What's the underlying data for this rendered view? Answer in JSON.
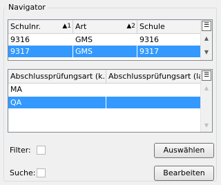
{
  "group": {
    "title": "Navigator"
  },
  "schools": {
    "columns": [
      {
        "label": "Schulnr.",
        "sort": "▲1"
      },
      {
        "label": "Art",
        "sort": "▲2"
      },
      {
        "label": "Schule",
        "sort": ""
      }
    ],
    "rows": [
      {
        "cells": [
          "9316",
          "GMS",
          "9316"
        ],
        "selected": false
      },
      {
        "cells": [
          "9317",
          "GMS",
          "9317"
        ],
        "selected": true
      }
    ]
  },
  "exams": {
    "columns": [
      {
        "label": "Abschlussprüfungsart (k..."
      },
      {
        "label": "Abschlussprüfungsart (lang)"
      }
    ],
    "rows": [
      {
        "cells": [
          "MA",
          ""
        ],
        "selected": false
      },
      {
        "cells": [
          "QA",
          ""
        ],
        "selected": true
      }
    ]
  },
  "filter": {
    "label": "Filter:",
    "checked": false
  },
  "search": {
    "label": "Suche:",
    "checked": false
  },
  "buttons": {
    "select": "Auswählen",
    "edit": "Bearbeiten"
  },
  "icons": {
    "column_chooser": "column-chooser-icon",
    "scroll_up": "scroll-up-icon",
    "scroll_down": "scroll-down-icon"
  },
  "colors": {
    "selection": "#3399ff",
    "background": "#f0f0f0"
  }
}
